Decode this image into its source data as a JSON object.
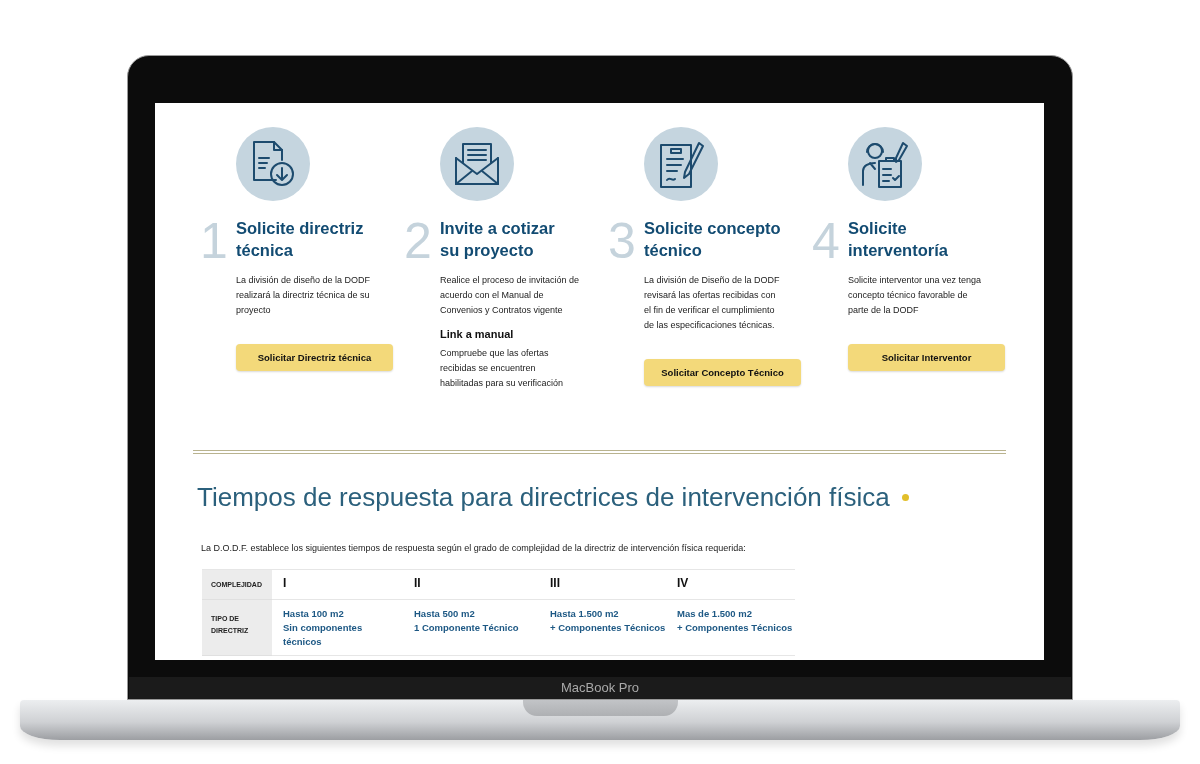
{
  "steps": [
    {
      "number": "1",
      "title_lines": [
        "Solicite directriz",
        "técnica"
      ],
      "text": "La división de diseño de la DODF realizará la directriz técnica de su proyecto",
      "button": "Solicitar Directriz técnica"
    },
    {
      "number": "2",
      "title_lines": [
        "Invite a cotizar",
        "su proyecto"
      ],
      "text": "Realice el proceso de invitación de acuerdo con el Manual de Convenios y Contratos vigente",
      "link": "Link a manual",
      "note": "Compruebe que las ofertas recibidas se encuentren habilitadas para su  verificación"
    },
    {
      "number": "3",
      "title_lines": [
        "Solicite concepto",
        "técnico"
      ],
      "text": "La división de Diseño de la DODF revisará las ofertas recibidas con el fin de verificar el cumplimiento de las especificaciones técnicas.",
      "button": "Solicitar Concepto Técnico"
    },
    {
      "number": "4",
      "title_lines": [
        "Solicite",
        "interventoría"
      ],
      "text": "Solicite interventor una vez tenga concepto técnico favorable de parte de la DODF",
      "button": "Solicitar Interventor"
    }
  ],
  "section": {
    "title": "Tiempos de respuesta para directrices de intervención física",
    "intro": "La D.O.D.F. establece los siguientes tiempos de respuesta según el grado de complejidad de la directriz de intervención física requerida:",
    "table": {
      "rows": [
        {
          "kind": "level",
          "label": "COMPLEJIDAD",
          "cells": [
            "I",
            "II",
            "III",
            "IV"
          ]
        },
        {
          "kind": "type",
          "label": "TIPO DE\nDIRECTRIZ",
          "cells": [
            "Hasta 100 m2\nSin componentes\ntécnicos",
            "Hasta 500 m2\n1 Componente Técnico",
            "Hasta 1.500 m2\n+ Componentes Técnicos",
            "Mas de 1.500 m2\n+ Componentes Técnicos"
          ]
        }
      ]
    }
  },
  "laptop": {
    "label": "MacBook Pro"
  }
}
